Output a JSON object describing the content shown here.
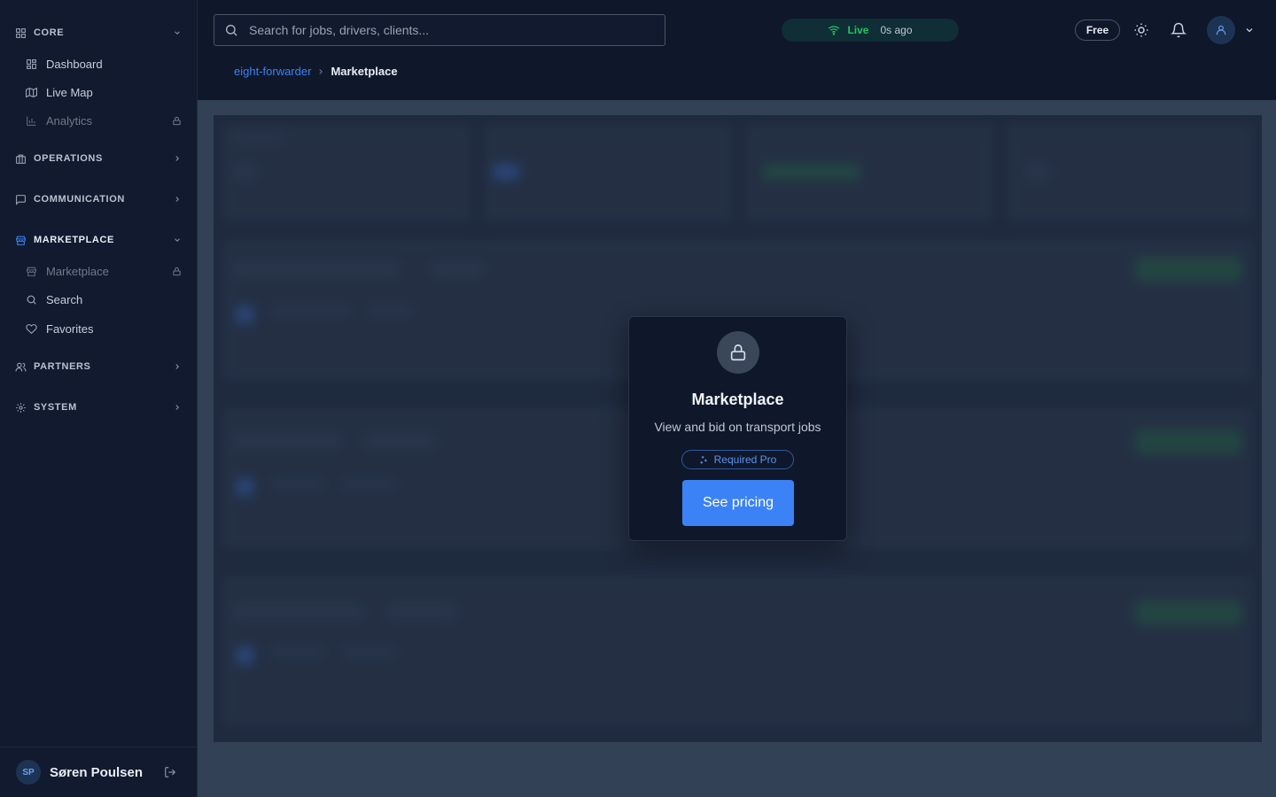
{
  "sidebar": {
    "sections": {
      "core": "CORE",
      "operations": "OPERATIONS",
      "communication": "COMMUNICATION",
      "marketplace": "MARKETPLACE",
      "partners": "PARTNERS",
      "system": "SYSTEM"
    },
    "core_items": {
      "dashboard": "Dashboard",
      "live_map": "Live Map",
      "analytics": "Analytics"
    },
    "marketplace_items": {
      "marketplace": "Marketplace",
      "search": "Search",
      "favorites": "Favorites"
    },
    "user": {
      "initials": "SP",
      "name": "Søren Poulsen"
    }
  },
  "header": {
    "search_placeholder": "Search for jobs, drivers, clients...",
    "status": {
      "live_label": "Live",
      "updated": "0s ago"
    },
    "plan": "Free"
  },
  "breadcrumb": {
    "root": "eight-forwarder",
    "current": "Marketplace"
  },
  "lock_card": {
    "title": "Marketplace",
    "description": "View and bid on transport jobs",
    "required": "Required Pro",
    "cta": "See pricing"
  },
  "colors": {
    "accent": "#3b82f6",
    "live": "#22c55e",
    "sidebar_bg": "#111a2e",
    "header_bg": "#0f172a"
  }
}
